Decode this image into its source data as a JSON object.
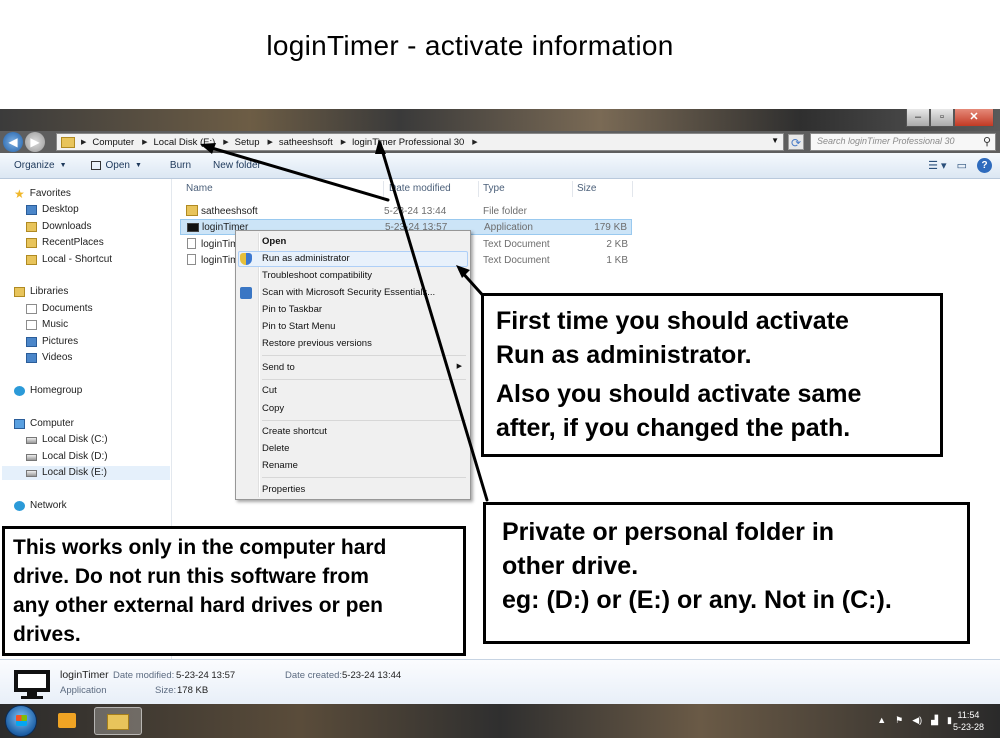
{
  "page_title": "loginTimer - activate information",
  "window": {
    "address": [
      "Computer",
      "Local Disk (E:)",
      "Setup",
      "satheeshsoft",
      "loginTimer Professional 30"
    ],
    "search_placeholder": "Search loginTimer Professional 30",
    "toolbar": {
      "organize": "Organize",
      "open": "Open",
      "burn": "Burn",
      "new_folder": "New folder"
    }
  },
  "nav": {
    "favorites": "Favorites",
    "desktop": "Desktop",
    "downloads": "Downloads",
    "recent": "RecentPlaces",
    "local_shortcut": "Local - Shortcut",
    "libraries": "Libraries",
    "documents": "Documents",
    "music": "Music",
    "pictures": "Pictures",
    "videos": "Videos",
    "homegroup": "Homegroup",
    "computer": "Computer",
    "disk_c": "Local Disk (C:)",
    "disk_d": "Local Disk (D:)",
    "disk_e": "Local Disk (E:)",
    "network": "Network"
  },
  "columns": {
    "name": "Name",
    "date": "Date modified",
    "type": "Type",
    "size": "Size"
  },
  "files": [
    {
      "name": "satheeshsoft",
      "date": "5-23-24 13:44",
      "type": "File folder",
      "size": ""
    },
    {
      "name": "loginTimer",
      "date": "5-23-24 13:57",
      "type": "Application",
      "size": "179 KB"
    },
    {
      "name": "loginTim",
      "date": "",
      "type": "Text Document",
      "size": "2 KB"
    },
    {
      "name": "loginTim",
      "date": "",
      "type": "Text Document",
      "size": "1 KB"
    }
  ],
  "context_menu": {
    "open": "Open",
    "run_admin": "Run as administrator",
    "troubleshoot": "Troubleshoot compatibility",
    "scan": "Scan with Microsoft Security Essentials...",
    "pin_taskbar": "Pin to Taskbar",
    "pin_start": "Pin to Start Menu",
    "restore": "Restore previous versions",
    "send_to": "Send to",
    "cut": "Cut",
    "copy": "Copy",
    "create_shortcut": "Create shortcut",
    "delete": "Delete",
    "rename": "Rename",
    "properties": "Properties"
  },
  "details": {
    "name": "loginTimer",
    "type": "Application",
    "modified_label": "Date modified:",
    "modified": "5-23-24 13:57",
    "created_label": "Date created:",
    "created": "5-23-24 13:44",
    "size_label": "Size:",
    "size": "178 KB"
  },
  "taskbar": {
    "time": "11:54",
    "date": "5-23-28"
  },
  "callouts": {
    "c1_line1": "First time you should activate",
    "c1_line2": "Run as administrator.",
    "c1_line3": "Also you should activate same",
    "c1_line4": "after, if you changed the path.",
    "c2_line1": "Private or personal folder in",
    "c2_line2": "other drive.",
    "c2_line3": "eg: (D:) or (E:) or any. Not in (C:).",
    "c3_line1": "This works only in the computer hard",
    "c3_line2": "drive. Do not run this software from",
    "c3_line3": "any other external hard drives or pen",
    "c3_line4": "drives."
  }
}
